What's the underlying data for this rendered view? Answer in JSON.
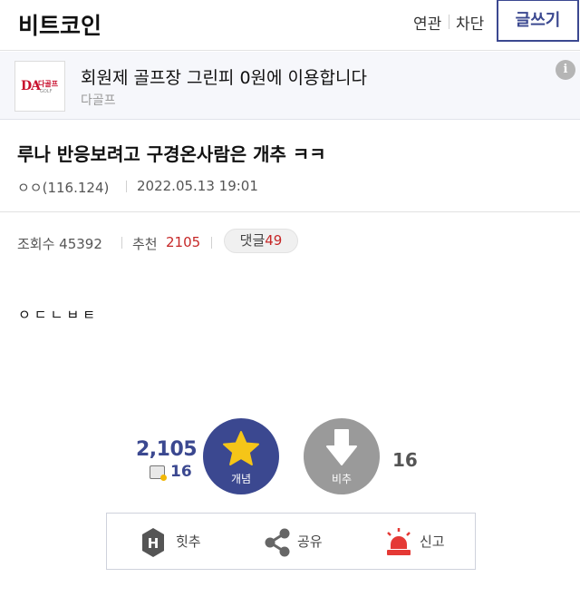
{
  "header": {
    "gallery_title": "비트코인",
    "related_label": "연관",
    "block_label": "차단",
    "write_label": "글쓰기"
  },
  "ad": {
    "logo_text": "DA",
    "logo_text_kr": "다골프",
    "logo_sub": "GOLF",
    "title": "회원제 골프장 그린피 0원에 이용합니다",
    "source": "다골프",
    "info_icon": "info-icon"
  },
  "post": {
    "title": "루나 반응보려고 구경온사람은 개추 ㅋㅋ",
    "author": "ㅇㅇ(116.124)",
    "date": "2022.05.13 19:01",
    "views_label": "조회수 45392",
    "recommend_label": "추천",
    "recommend_value": "2105",
    "comment_label": "댓글",
    "comment_count": "49",
    "body": "ㅇㄷㄴㅂㅌ"
  },
  "vote": {
    "up_count": "2,105",
    "fix_count": "16",
    "up_label": "개념",
    "down_label": "비추",
    "down_count": "16"
  },
  "actions": {
    "hit_label": "힛추",
    "share_label": "공유",
    "report_label": "신고"
  },
  "colors": {
    "accent": "#3b4890",
    "red": "#c62828",
    "star": "#f5c518",
    "down": "#9a9a9a",
    "siren": "#e53935"
  }
}
